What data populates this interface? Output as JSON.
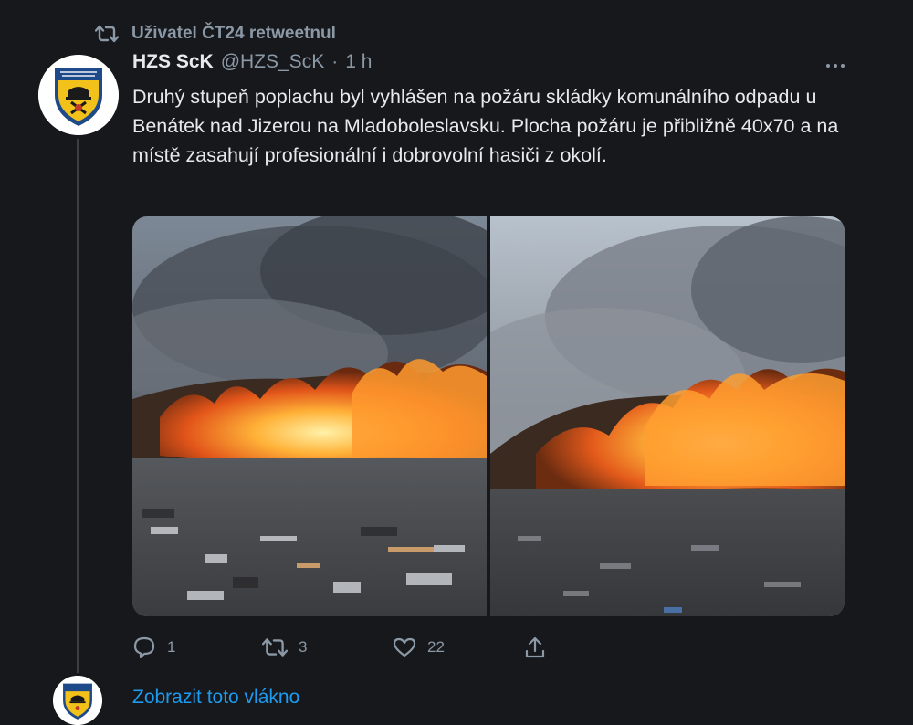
{
  "retweet": {
    "label": "Uživatel ČT24 retweetnul"
  },
  "tweet": {
    "author_name": "HZS ScK",
    "author_handle": "@HZS_ScK",
    "separator": "·",
    "time": "1 h",
    "text": "Druhý stupeň poplachu byl vyhlášen na požáru skládky komunálního odpadu u Benátek nad Jizerou na Mladoboleslavsku. Plocha požáru je přibližně 40x70 a na místě zasahují profesionální i dobrovolní hasiči z okolí.",
    "media": [
      {
        "label": "landfill-fire-photo-1"
      },
      {
        "label": "landfill-fire-photo-2"
      }
    ],
    "actions": {
      "replies": "1",
      "retweets": "3",
      "likes": "22",
      "share": ""
    }
  },
  "thread": {
    "show_label": "Zobrazit toto vlákno"
  },
  "icons": {
    "retweet": "retweet-icon",
    "reply": "reply-icon",
    "like": "heart-icon",
    "share": "share-icon",
    "more": "more-icon"
  },
  "colors": {
    "background": "#16181c",
    "text": "#e7e9ea",
    "muted": "#8b98a5",
    "link": "#1d9bf0"
  }
}
